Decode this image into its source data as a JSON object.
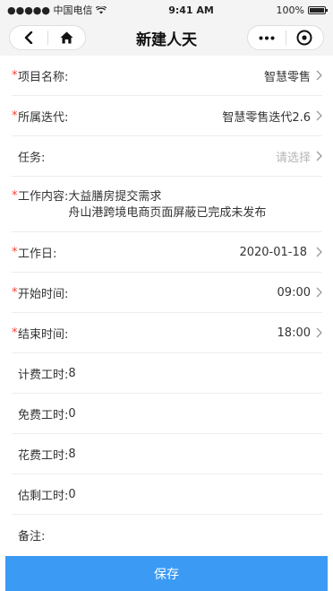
{
  "status": {
    "carrier": "●●●●● 中国电信",
    "time": "9:41 AM",
    "battery": "100%"
  },
  "nav": {
    "title": "新建人天"
  },
  "form": {
    "project": {
      "label": "项目名称:",
      "value": "智慧零售"
    },
    "iteration": {
      "label": "所属迭代:",
      "value": "智慧零售迭代2.6"
    },
    "task": {
      "label": "任务:",
      "placeholder": "请选择"
    },
    "work_content": {
      "label": "工作内容:",
      "line1": "大益膳房提交需求",
      "line2": "舟山港跨境电商页面屏蔽已完成未发布"
    },
    "work_day": {
      "label": "工作日:",
      "value": "2020-01-18"
    },
    "start_time": {
      "label": "开始时间:",
      "value": "09:00"
    },
    "end_time": {
      "label": "结束时间:",
      "value": "18:00"
    },
    "billable_hours": {
      "label": "计费工时:",
      "value": "8"
    },
    "free_hours": {
      "label": "免费工时:",
      "value": "0"
    },
    "spent_hours": {
      "label": "花费工时:",
      "value": "8"
    },
    "remaining_hours": {
      "label": "估剩工时:",
      "value": "0"
    },
    "notes": {
      "label": "备注:"
    }
  },
  "save_button": {
    "label": "保存"
  },
  "colors": {
    "accent": "#3a9af4",
    "required": "#f44336"
  }
}
